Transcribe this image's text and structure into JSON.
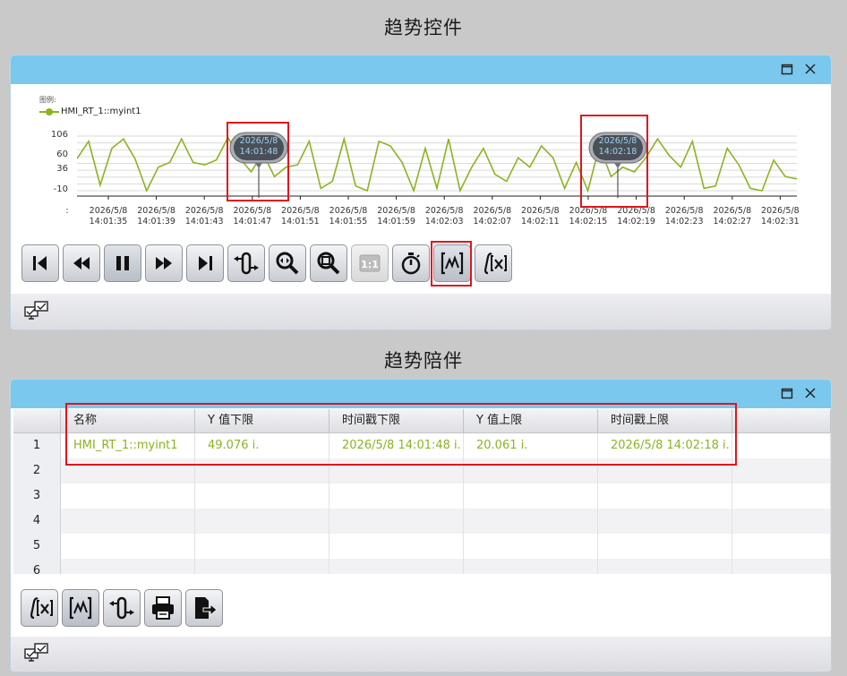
{
  "titles": {
    "trend_control": "趋势控件",
    "trend_companion": "趋势陪伴"
  },
  "legend": {
    "title": "图例:",
    "series_name": "HMI_RT_1::myint1",
    "color": "#8cb321"
  },
  "chart_data": {
    "type": "line",
    "y_ticks": [
      "106",
      "60",
      "36",
      "-10"
    ],
    "y_tick_values": [
      106,
      60,
      36,
      -10
    ],
    "x_tick_dates": [
      "2026/5/8",
      "2026/5/8",
      "2026/5/8",
      "2026/5/8",
      "2026/5/8",
      "2026/5/8",
      "2026/5/8",
      "2026/5/8",
      "2026/5/8",
      "2026/5/8",
      "2026/5/8",
      "2026/5/8",
      "2026/5/8",
      "2026/5/8",
      "2026/5/8"
    ],
    "x_tick_times": [
      "14:01:35",
      "14:01:39",
      "14:01:43",
      "14:01:47",
      "14:01:51",
      "14:01:55",
      "14:01:59",
      "14:02:03",
      "14:02:07",
      "14:02:11",
      "14:02:15",
      "14:02:19",
      "14:02:23",
      "14:02:27",
      "14:02:31"
    ],
    "series": [
      {
        "name": "HMI_RT_1::myint1",
        "values": [
          58,
          95,
          2,
          80,
          100,
          58,
          -10,
          40,
          50,
          100,
          50,
          45,
          55,
          103,
          60,
          30,
          70,
          20,
          40,
          45,
          95,
          -5,
          10,
          100,
          0,
          -10,
          95,
          85,
          50,
          -10,
          80,
          -5,
          100,
          -10,
          40,
          80,
          25,
          10,
          60,
          40,
          85,
          60,
          -5,
          50,
          -10,
          85,
          20,
          40,
          30,
          60,
          100,
          65,
          40,
          95,
          -5,
          0,
          80,
          45,
          -5,
          -10,
          55,
          20,
          15
        ]
      }
    ],
    "cursors": [
      {
        "date": "2026/5/8",
        "time": "14:01:48"
      },
      {
        "date": "2026/5/8",
        "time": "14:02:18"
      }
    ]
  },
  "toolbar1": [
    {
      "name": "first-icon"
    },
    {
      "name": "rewind-icon"
    },
    {
      "name": "pause-icon"
    },
    {
      "name": "forward-icon"
    },
    {
      "name": "last-icon"
    },
    {
      "name": "ruler-icon"
    },
    {
      "name": "zoom-in-icon"
    },
    {
      "name": "zoom-out-icon"
    },
    {
      "name": "original-size-icon"
    },
    {
      "name": "stopwatch-icon"
    },
    {
      "name": "trend-area-icon"
    },
    {
      "name": "statistics-icon"
    }
  ],
  "table": {
    "headers": [
      "名称",
      "Y 值下限",
      "时间戳下限",
      "Y 值上限",
      "时间戳上限"
    ],
    "rows": [
      {
        "num": "1",
        "cells": [
          "HMI_RT_1::myint1",
          "49.076 i.",
          "2026/5/8 14:01:48 i.",
          "20.061 i.",
          "2026/5/8 14:02:18 i."
        ]
      },
      {
        "num": "2",
        "cells": [
          "",
          "",
          "",
          "",
          ""
        ]
      },
      {
        "num": "3",
        "cells": [
          "",
          "",
          "",
          "",
          ""
        ]
      },
      {
        "num": "4",
        "cells": [
          "",
          "",
          "",
          "",
          ""
        ]
      },
      {
        "num": "5",
        "cells": [
          "",
          "",
          "",
          "",
          ""
        ]
      },
      {
        "num": "6",
        "cells": [
          "",
          "",
          "",
          "",
          ""
        ]
      }
    ]
  }
}
